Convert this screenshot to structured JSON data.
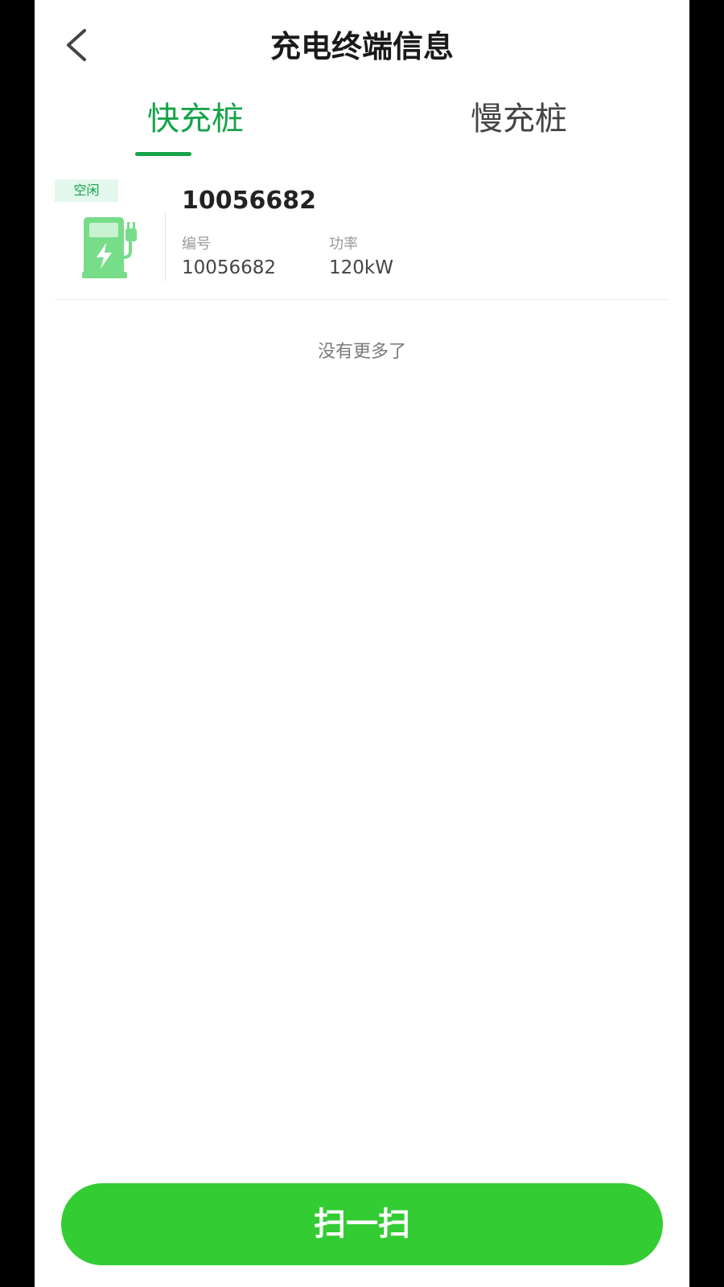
{
  "header": {
    "title": "充电终端信息",
    "back_icon": "chevron-left-icon"
  },
  "tabs": [
    {
      "label": "快充桩",
      "active": true
    },
    {
      "label": "慢充桩",
      "active": false
    }
  ],
  "colors": {
    "accent": "#16a34a",
    "button": "#33cc33",
    "badge_bg": "#e3f8ec",
    "icon_green": "#77dd88"
  },
  "chargers": [
    {
      "status": "空闲",
      "name": "10056682",
      "icon": "charging-station-icon",
      "number_label": "编号",
      "number_value": "10056682",
      "power_label": "功率",
      "power_value": "120kW"
    }
  ],
  "list_footer": "没有更多了",
  "scan_button": {
    "label": "扫一扫"
  }
}
